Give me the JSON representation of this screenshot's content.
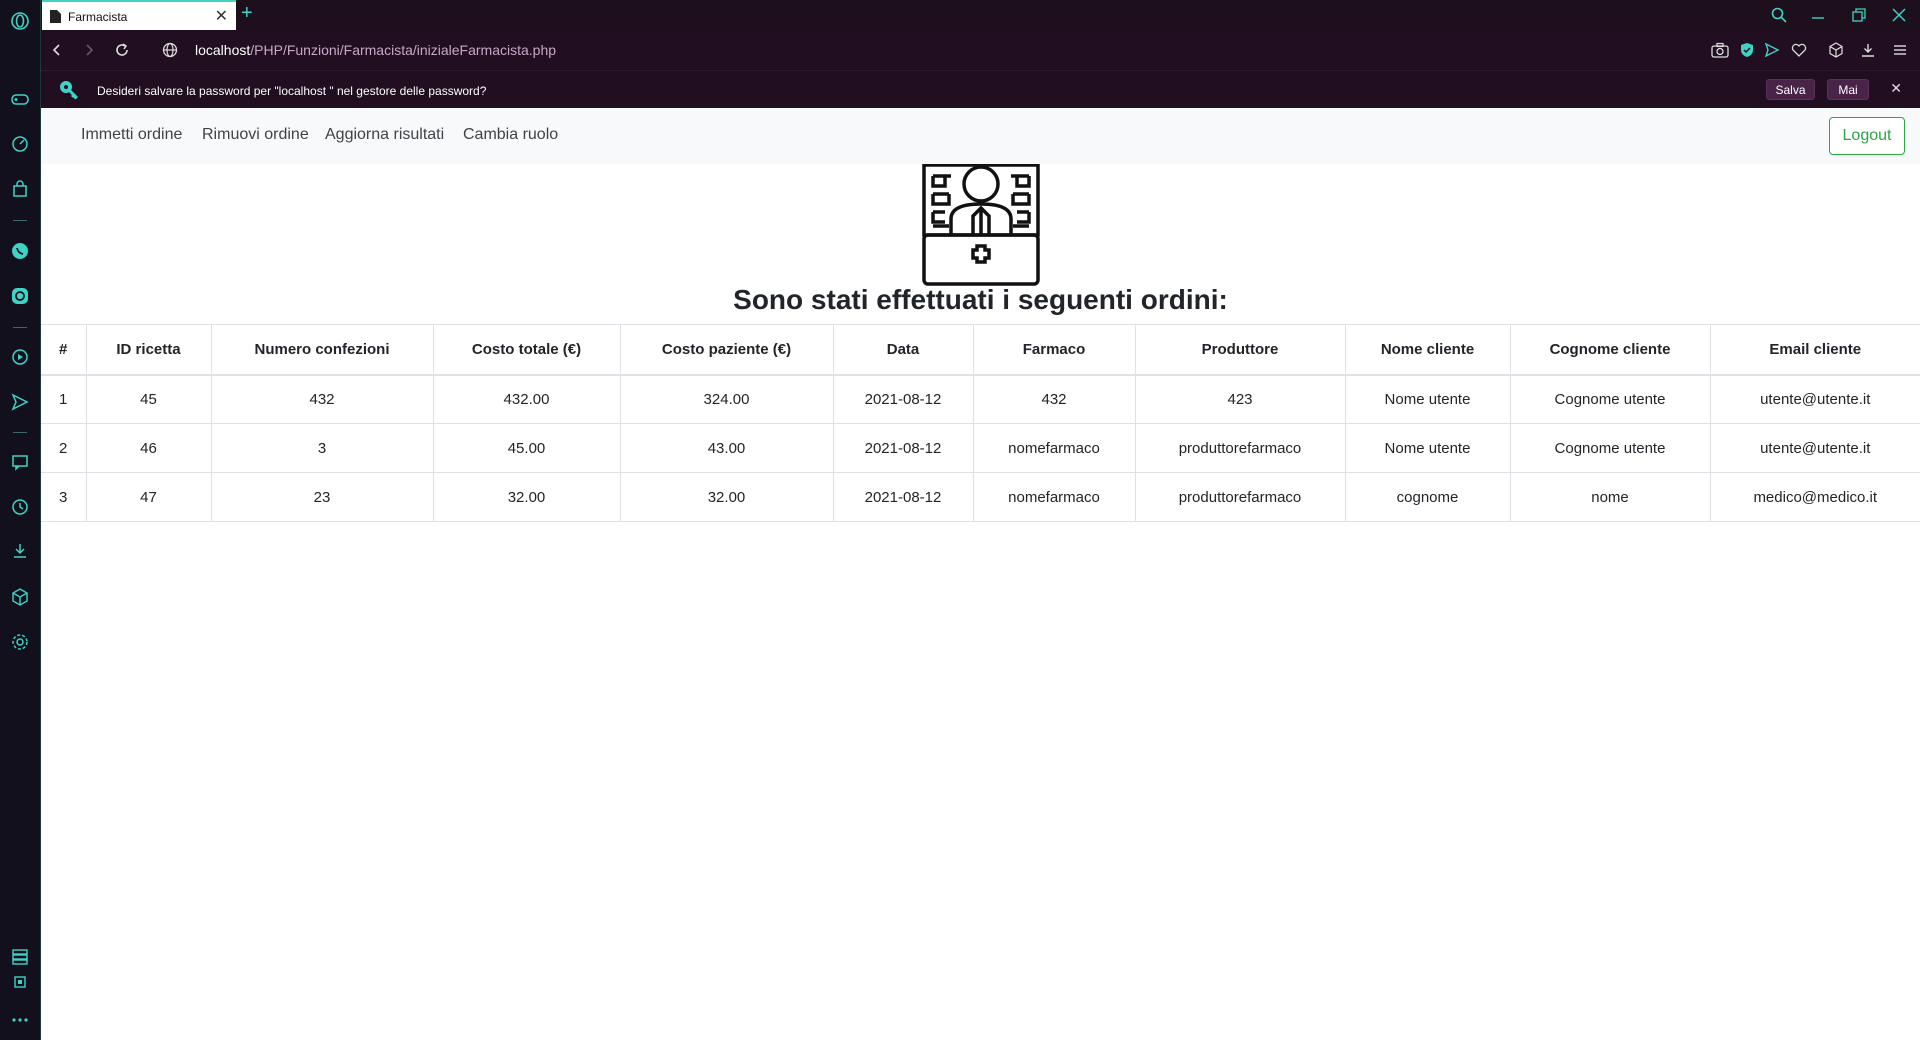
{
  "browser": {
    "tab": {
      "title": "Farmacista"
    },
    "address": {
      "host": "localhost",
      "path": "/PHP/Funzioni/Farmacista/inizialeFarmacista.php"
    },
    "infobar": {
      "message": "Desideri salvare la password per \"localhost \" nel gestore delle password?",
      "save_label": "Salva",
      "never_label": "Mai"
    }
  },
  "navbar": {
    "links": [
      "Immetti ordine",
      "Rimuovi ordine",
      "Aggiorna risultati",
      "Cambia ruolo"
    ],
    "logout_label": "Logout"
  },
  "main": {
    "heading": "Sono stati effettuati i seguenti ordini:"
  },
  "table": {
    "headers": [
      "#",
      "ID ricetta",
      "Numero confezioni",
      "Costo totale (€)",
      "Costo paziente (€)",
      "Data",
      "Farmaco",
      "Produttore",
      "Nome cliente",
      "Cognome cliente",
      "Email cliente"
    ],
    "rows": [
      [
        "1",
        "45",
        "432",
        "432.00",
        "324.00",
        "2021-08-12",
        "432",
        "423",
        "Nome utente",
        "Cognome utente",
        "utente@utente.it"
      ],
      [
        "2",
        "46",
        "3",
        "45.00",
        "43.00",
        "2021-08-12",
        "nomefarmaco",
        "produttorefarmaco",
        "Nome utente",
        "Cognome utente",
        "utente@utente.it"
      ],
      [
        "3",
        "47",
        "23",
        "32.00",
        "32.00",
        "2021-08-12",
        "nomefarmaco",
        "produttorefarmaco",
        "cognome",
        "nome",
        "medico@medico.it"
      ]
    ]
  },
  "colors": {
    "accent": "#3fd3c5",
    "logout": "#28a745",
    "chrome": "#210e20"
  }
}
